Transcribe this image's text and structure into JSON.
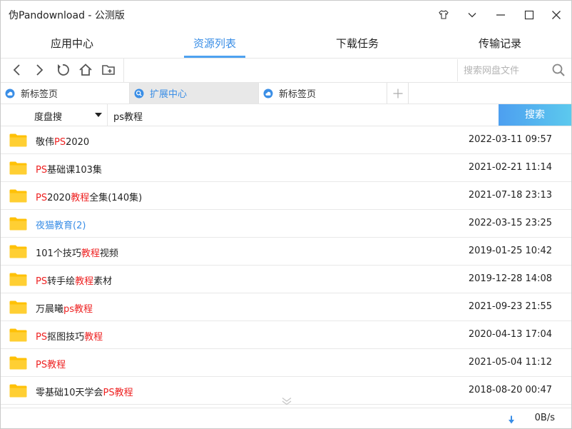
{
  "window": {
    "title": "伪Pandownload - 公测版"
  },
  "nav": {
    "tabs": [
      {
        "label": "应用中心"
      },
      {
        "label": "资源列表"
      },
      {
        "label": "下载任务"
      },
      {
        "label": "传输记录"
      }
    ],
    "active": 1
  },
  "toolbar": {
    "search_placeholder": "搜索网盘文件"
  },
  "browser_tabs": [
    {
      "label": "新标签页"
    },
    {
      "label": "扩展中心"
    },
    {
      "label": "新标签页"
    }
  ],
  "search": {
    "engine": "度盘搜",
    "query": "ps教程",
    "button": "搜索"
  },
  "results": [
    {
      "name": [
        [
          "敬伟",
          0
        ],
        [
          "PS",
          1
        ],
        [
          "2020",
          0
        ]
      ],
      "date": "2022-03-11 09:57"
    },
    {
      "name": [
        [
          "PS",
          1
        ],
        [
          "基础课103集",
          0
        ]
      ],
      "date": "2021-02-21 11:14"
    },
    {
      "name": [
        [
          "PS",
          1
        ],
        [
          "2020",
          0
        ],
        [
          "教程",
          1
        ],
        [
          "全集(140集)",
          0
        ]
      ],
      "date": "2021-07-18 23:13"
    },
    {
      "name": [
        [
          "夜猫教育(2)",
          2
        ]
      ],
      "date": "2022-03-15 23:25"
    },
    {
      "name": [
        [
          "101个技巧",
          0
        ],
        [
          "教程",
          1
        ],
        [
          "视频",
          0
        ]
      ],
      "date": "2019-01-25 10:42"
    },
    {
      "name": [
        [
          "PS",
          1
        ],
        [
          "转手绘",
          0
        ],
        [
          "教程",
          1
        ],
        [
          "素材",
          0
        ]
      ],
      "date": "2019-12-28 14:08"
    },
    {
      "name": [
        [
          "万晨曦",
          0
        ],
        [
          "ps教程",
          1
        ]
      ],
      "date": "2021-09-23 21:55"
    },
    {
      "name": [
        [
          "PS",
          1
        ],
        [
          "抠图技巧",
          0
        ],
        [
          "教程",
          1
        ]
      ],
      "date": "2020-04-13 17:04"
    },
    {
      "name": [
        [
          "PS教程",
          1
        ]
      ],
      "date": "2021-05-04 11:12"
    },
    {
      "name": [
        [
          "零基础10天学会",
          0
        ],
        [
          "PS教程",
          1
        ]
      ],
      "date": "2018-08-20 00:47"
    }
  ],
  "status": {
    "speed": "0B/s"
  },
  "colors": {
    "accent": "#3a8ee6",
    "highlight": "#e22222",
    "folder": "#ffc107",
    "search_button_start": "#4d9ff0",
    "search_button_end": "#5cc9ee"
  }
}
